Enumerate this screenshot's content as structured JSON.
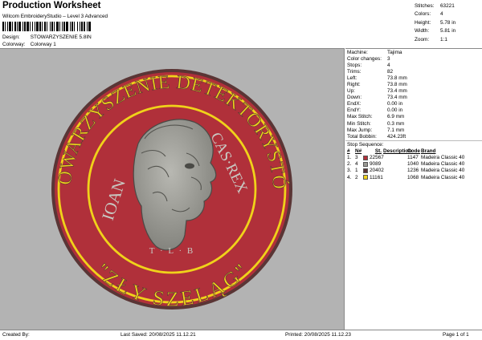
{
  "header": {
    "title": "Production Worksheet",
    "studio": "Wilcom EmbroideryStudio – Level 3 Advanced",
    "design_label": "Design:",
    "design_value": "STOWARZYSZENIE 5.8IN",
    "colorway_label": "Colorway:",
    "colorway_value": "Colorway 1"
  },
  "stats": [
    {
      "label": "Stitches:",
      "value": "63221"
    },
    {
      "label": "Colors:",
      "value": "4"
    },
    {
      "label": "Height:",
      "value": "5.78 in"
    },
    {
      "label": "Width:",
      "value": "5.81 in"
    },
    {
      "label": "Zoom:",
      "value": "1:1"
    }
  ],
  "info": [
    {
      "label": "Machine:",
      "value": "Tajima"
    },
    {
      "label": "Color changes:",
      "value": "3"
    },
    {
      "label": "Stops:",
      "value": "4"
    },
    {
      "label": "Trims:",
      "value": "82"
    },
    {
      "label": "Left:",
      "value": "73.8 mm"
    },
    {
      "label": "Right:",
      "value": "73.8 mm"
    },
    {
      "label": "Up:",
      "value": "73.4 mm"
    },
    {
      "label": "Down:",
      "value": "73.4 mm"
    },
    {
      "label": "EndX:",
      "value": "0.00 in"
    },
    {
      "label": "EndY:",
      "value": "0.00 in"
    },
    {
      "label": "Max Stitch:",
      "value": "6.9 mm"
    },
    {
      "label": "Min Stitch:",
      "value": "0.3 mm"
    },
    {
      "label": "Max Jump:",
      "value": "7.1 mm"
    },
    {
      "label": "Total Bobbin:",
      "value": "424.23ft"
    }
  ],
  "stop_sequence": {
    "title": "Stop Sequence:",
    "headers": {
      "n": "#",
      "ci": "N#",
      "st": "St.",
      "desc": "Description",
      "code": "Code",
      "brand": "Brand"
    },
    "rows": [
      {
        "n": "1.",
        "ci": "3",
        "color": "#b0303a",
        "st": "22567",
        "code": "1147",
        "brand": "Madeira Classic 40"
      },
      {
        "n": "2.",
        "ci": "4",
        "color": "#9a9a94",
        "st": "9089",
        "code": "1040",
        "brand": "Madeira Classic 40"
      },
      {
        "n": "3.",
        "ci": "1",
        "color": "#5a3535",
        "st": "20402",
        "code": "1236",
        "brand": "Madeira Classic 40"
      },
      {
        "n": "4.",
        "ci": "2",
        "color": "#f0d21a",
        "st": "11161",
        "code": "1068",
        "brand": "Madeira Classic 40"
      }
    ]
  },
  "patch": {
    "top_text": "STOWARZYSZENIE DETEKTORYSTÓW",
    "bottom_text": "\"ZŁY SZELĄG\"",
    "left_text": "IOAN",
    "right_text": "CAS·REX",
    "initials": "T · L · B",
    "colors": {
      "red": "#b0303a",
      "gold": "#f0d21a",
      "brown": "#5a3535",
      "gray": "#9a9a94",
      "bg": "#b3b3b3"
    }
  },
  "footer": {
    "created_by": "Created By:",
    "last_saved": "Last Saved: 20/08/2025 11.12.21",
    "printed": "Printed: 20/08/2025 11.12.23",
    "page": "Page 1 of 1"
  }
}
